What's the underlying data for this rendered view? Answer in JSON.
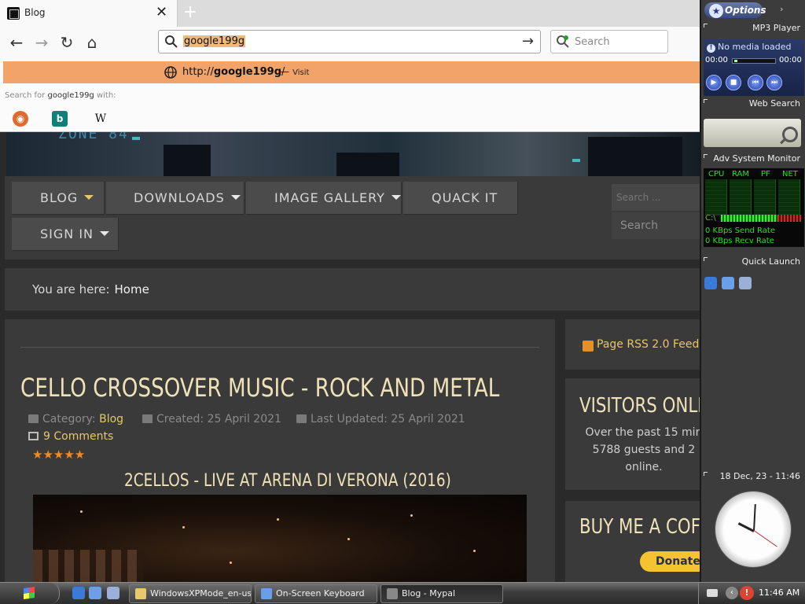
{
  "browser": {
    "tab": {
      "title": "Blog",
      "close_glyph": "✕"
    },
    "newtab_glyph": "+",
    "nav": {
      "back": "←",
      "forward": "→",
      "reload": "↻",
      "home": "⌂"
    },
    "url": {
      "value": "google199g",
      "go_glyph": "→"
    },
    "search": {
      "placeholder": "Search"
    },
    "dropdown": {
      "suggest_prefix": "http://",
      "suggest_domain": "google199g",
      "suggest_suffix": "/",
      "visit_dash": "—",
      "visit_label": "Visit",
      "search_with_prefix": "Search for",
      "search_with_term": "google199g",
      "search_with_suffix": "with:",
      "engines": {
        "ddg": "◉",
        "bing": "b",
        "wiki": "W"
      }
    }
  },
  "site": {
    "hero_logo": "ZONE 84",
    "menu": [
      {
        "label": "BLOG",
        "caret": true,
        "active": true
      },
      {
        "label": "DOWNLOADS",
        "caret": true
      },
      {
        "label": "IMAGE GALLERY",
        "caret": true
      },
      {
        "label": "QUACK IT",
        "caret": false
      },
      {
        "label": "SIGN IN",
        "caret": true
      }
    ],
    "search_placeholder": "Search ...",
    "search_button": "Search",
    "breadcrumb": {
      "prefix": "You are here:",
      "current": "Home"
    },
    "article": {
      "title": "CELLO CROSSOVER MUSIC - ROCK AND METAL",
      "category_label": "Category:",
      "category": "Blog",
      "created": "Created: 25 April 2021",
      "updated": "Last Updated: 25 April 2021",
      "comments": "9 Comments",
      "stars": "★★★★★",
      "video_title": "2CELLOS - LIVE AT ARENA DI VERONA (2016)"
    },
    "rss": "Page RSS 2.0 Feed",
    "visitors": {
      "title": "VISITORS ONLI",
      "line1": "Over the past 15 min",
      "line2": "5788 guests and 2",
      "line3": "online."
    },
    "coffee": {
      "title": "BUY ME A COFF",
      "donate": "Donate"
    }
  },
  "sidebar": {
    "options": "Options",
    "options_arrow": "›",
    "mp3": {
      "title": "MP3 Player",
      "info_glyph": "!",
      "status": "No media loaded",
      "time_left": "00:00",
      "time_right": "00:00",
      "buttons": [
        "▶",
        "■",
        "⏮",
        "⏭"
      ]
    },
    "web_search": "Web Search",
    "sysmon": {
      "title": "Adv System Monitor",
      "heads": [
        "CPU",
        "RAM",
        "PF",
        "NET"
      ],
      "drive": "C:\\",
      "send": "0 KBps Send Rate",
      "recv": "0 KBps Recv Rate"
    },
    "quick_launch": "Quick Launch",
    "clock_date": "18 Dec, 23 - 11:46"
  },
  "taskbar": {
    "tasks": [
      {
        "label": "WindowsXPMode_en-us",
        "icon": "#e8c86a"
      },
      {
        "label": "On-Screen Keyboard",
        "icon": "#6a9ee8"
      },
      {
        "label": "Blog - Mypal",
        "icon": "#888888",
        "active": true
      }
    ],
    "tray_arrow": "‹",
    "tray_alert": "!",
    "time": "11:46 AM"
  },
  "colors": {
    "accent_gold": "#e6c66a",
    "url_highlight": "#f2a369",
    "title_cream": "#f0e2b8"
  }
}
